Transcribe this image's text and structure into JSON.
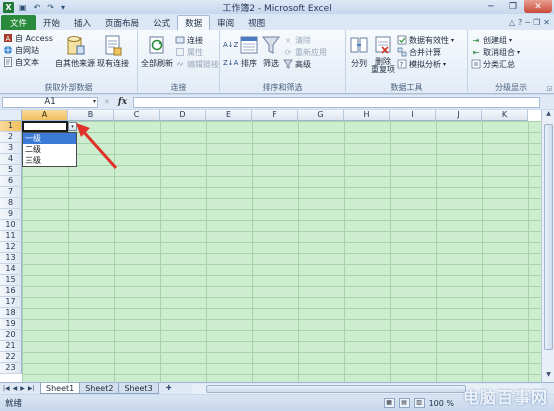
{
  "window": {
    "title": "工作簿2 - Microsoft Excel",
    "logo": "X",
    "save_glyph": "▣",
    "undo_glyph": "↶",
    "redo_glyph": "↷",
    "qat_more_glyph": "▾",
    "minimize_glyph": "─",
    "restore_glyph": "❐",
    "close_glyph": "✕"
  },
  "tabs": [
    {
      "label": "文件"
    },
    {
      "label": "开始"
    },
    {
      "label": "插入"
    },
    {
      "label": "页面布局"
    },
    {
      "label": "公式"
    },
    {
      "label": "数据"
    },
    {
      "label": "审阅"
    },
    {
      "label": "视图"
    }
  ],
  "active_tab": "数据",
  "ribbon_right": {
    "collapse_glyph": "△",
    "help_glyph": "?",
    "min_glyph": "─",
    "restore_glyph": "❐",
    "close_glyph": "✕"
  },
  "ribbon": {
    "get_external": {
      "label": "获取外部数据",
      "access": "自 Access",
      "web": "自网站",
      "text": "自文本",
      "other_sources": "自其他来源",
      "existing": "现有连接"
    },
    "connections": {
      "label": "连接",
      "refresh_all": "全部刷新",
      "connections": "连接",
      "properties": "属性",
      "edit_links": "编辑链接"
    },
    "sort_filter": {
      "label": "排序和筛选",
      "sort_az": "A↓Z",
      "sort_za": "Z↓A",
      "sort": "排序",
      "filter": "筛选",
      "clear": "清除",
      "reapply": "重新应用",
      "advanced": "高级"
    },
    "data_tools": {
      "label": "数据工具",
      "text_to_columns": "分列",
      "remove_dupes": "删除\n重复项",
      "validation": "数据有效性",
      "consolidate": "合并计算",
      "what_if": "模拟分析"
    },
    "outline": {
      "label": "分级显示",
      "group": "创建组",
      "ungroup": "取消组合",
      "subtotal": "分类汇总"
    }
  },
  "formula_bar": {
    "name_box": "A1",
    "fx": "fx",
    "cancel": "✕",
    "dd_glyph": "▾",
    "formula": ""
  },
  "grid": {
    "columns": [
      "A",
      "B",
      "C",
      "D",
      "E",
      "F",
      "G",
      "H",
      "I",
      "J",
      "K"
    ],
    "rows": [
      "1",
      "2",
      "3",
      "4",
      "5",
      "6",
      "7",
      "8",
      "9",
      "10",
      "11",
      "12",
      "13",
      "14",
      "15",
      "16",
      "17",
      "18",
      "19",
      "20",
      "21",
      "22",
      "23"
    ],
    "active_cell": "A1",
    "dropdown_glyph": "▾",
    "dropdown_options": [
      "一级",
      "二级",
      "三级"
    ],
    "dropdown_selected": "一级"
  },
  "arrow_color": "#e0302a",
  "sheets": {
    "tabs": [
      "Sheet1",
      "Sheet2",
      "Sheet3"
    ],
    "active": "Sheet1",
    "nav": [
      "|◀",
      "◀",
      "▶",
      "▶|"
    ],
    "new_sheet_glyph": "✚"
  },
  "status": {
    "ready": "就绪",
    "zoom": "100 %",
    "view_glyphs": [
      "▦",
      "▤",
      "▥"
    ]
  },
  "watermark": "电脑百事网"
}
